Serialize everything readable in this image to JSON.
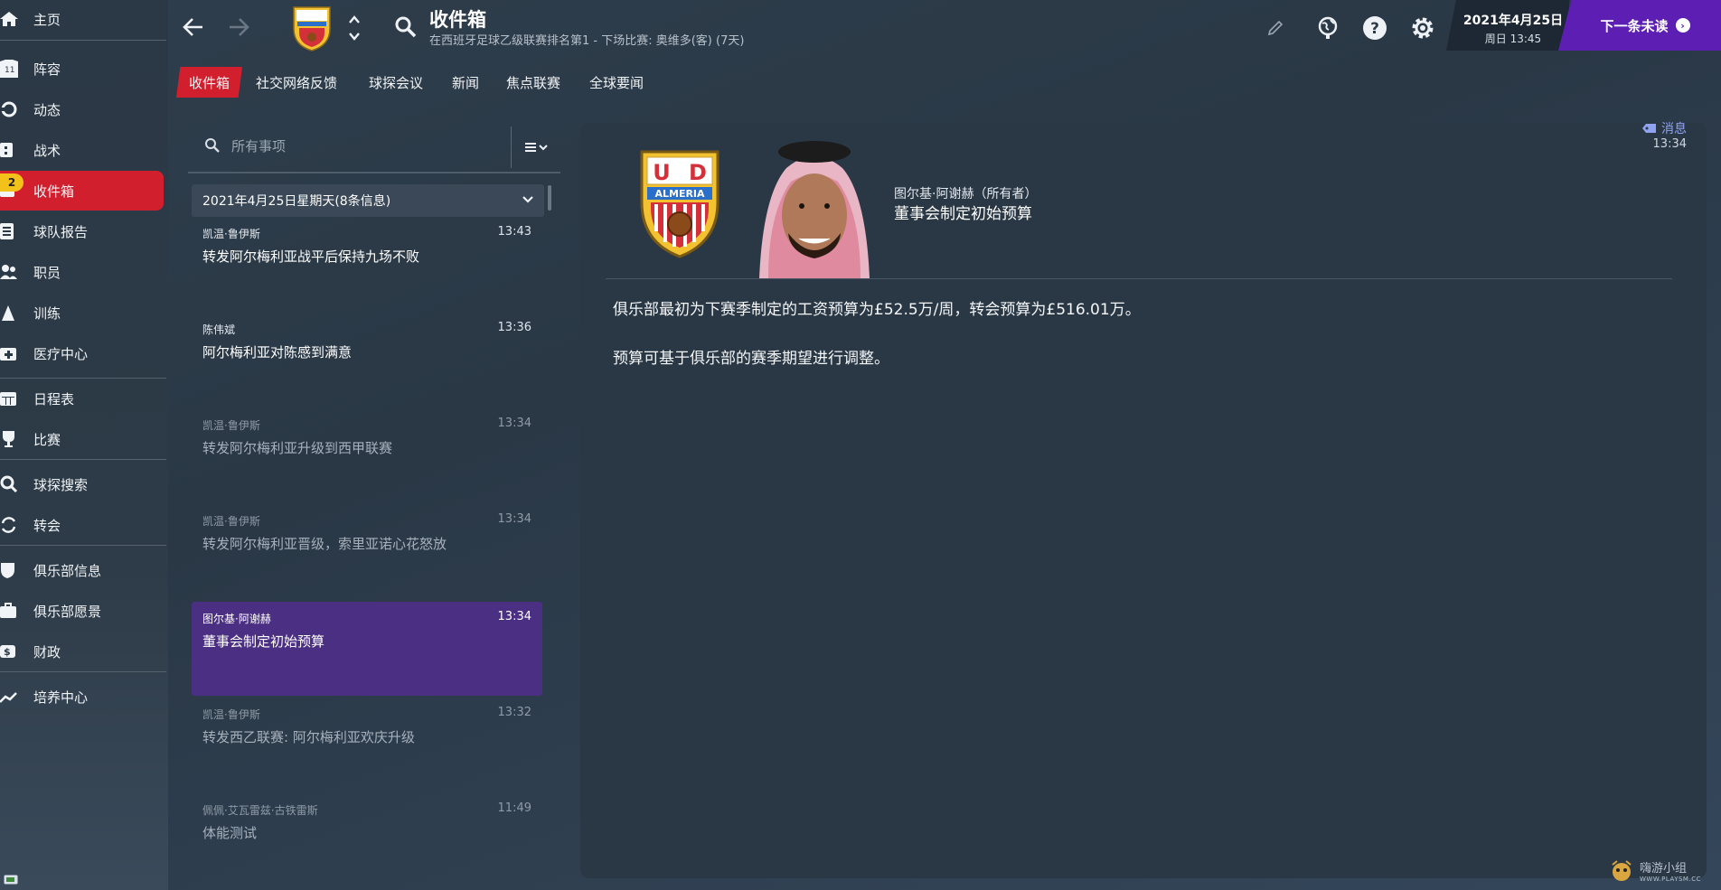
{
  "sidebar": {
    "items": [
      {
        "label": "主页",
        "icon": "home-icon"
      },
      {
        "label": "阵容",
        "icon": "shirt-icon"
      },
      {
        "label": "动态",
        "icon": "dynamics-icon"
      },
      {
        "label": "战术",
        "icon": "tactics-icon"
      },
      {
        "label": "收件箱",
        "icon": "inbox-icon",
        "badge": "2"
      },
      {
        "label": "球队报告",
        "icon": "report-icon"
      },
      {
        "label": "职员",
        "icon": "staff-icon"
      },
      {
        "label": "训练",
        "icon": "training-icon"
      },
      {
        "label": "医疗中心",
        "icon": "medical-icon"
      },
      {
        "label": "日程表",
        "icon": "calendar-icon"
      },
      {
        "label": "比赛",
        "icon": "trophy-icon"
      },
      {
        "label": "球探搜索",
        "icon": "search-icon"
      },
      {
        "label": "转会",
        "icon": "transfer-icon"
      },
      {
        "label": "俱乐部信息",
        "icon": "shield-icon"
      },
      {
        "label": "俱乐部愿景",
        "icon": "briefcase-icon"
      },
      {
        "label": "财政",
        "icon": "finance-icon"
      },
      {
        "label": "培养中心",
        "icon": "development-icon"
      }
    ]
  },
  "topbar": {
    "title": "收件箱",
    "subtitle": "在西班牙足球乙级联赛排名第1 - 下场比赛: 奥维多(客) (7天)",
    "date": "2021年4月25日",
    "weekday_time": "周日 13:45",
    "next_button": "下一条未读"
  },
  "tabs": [
    "收件箱",
    "社交网络反馈",
    "球探会议",
    "新闻",
    "焦点联赛",
    "全球要闻"
  ],
  "inbox": {
    "search_placeholder": "所有事项",
    "group_label": "2021年4月25日星期天(8条信息)",
    "messages": [
      {
        "sender": "凯温·鲁伊斯",
        "time": "13:43",
        "subject": "转发阿尔梅利亚战平后保持九场不败",
        "state": "unread"
      },
      {
        "sender": "陈伟斌",
        "time": "13:36",
        "subject": "阿尔梅利亚对陈感到满意",
        "state": "unread"
      },
      {
        "sender": "凯温·鲁伊斯",
        "time": "13:34",
        "subject": "转发阿尔梅利亚升级到西甲联赛",
        "state": "read"
      },
      {
        "sender": "凯温·鲁伊斯",
        "time": "13:34",
        "subject": "转发阿尔梅利亚晋级，索里亚诺心花怒放",
        "state": "read"
      },
      {
        "sender": "图尔基·阿谢赫",
        "time": "13:34",
        "subject": "董事会制定初始预算",
        "state": "selected"
      },
      {
        "sender": "凯温·鲁伊斯",
        "time": "13:32",
        "subject": "转发西乙联赛: 阿尔梅利亚欢庆升级",
        "state": "read"
      },
      {
        "sender": "佩佩·艾瓦雷兹·古铁雷斯",
        "time": "11:49",
        "subject": "体能测试",
        "state": "read"
      }
    ]
  },
  "detail": {
    "owner": "图尔基·阿谢赫（所有者）",
    "subject": "董事会制定初始预算",
    "tag": "消息",
    "time": "13:34",
    "paragraphs": [
      "俱乐部最初为下赛季制定的工资预算为£52.5万/周，转会预算为£516.01万。",
      "预算可基于俱乐部的赛季期望进行调整。"
    ],
    "crest_text": {
      "top_left": "U",
      "top_right": "D",
      "band": "ALMERIA"
    }
  },
  "watermark": {
    "main": "嗨游小组",
    "sub": "WWW.PLAYSM.CC"
  },
  "colors": {
    "accent_red": "#d21f2e",
    "accent_purple": "#5d1fb3",
    "selected_row": "#4b2f82",
    "badge_yellow": "#f3c21a"
  }
}
